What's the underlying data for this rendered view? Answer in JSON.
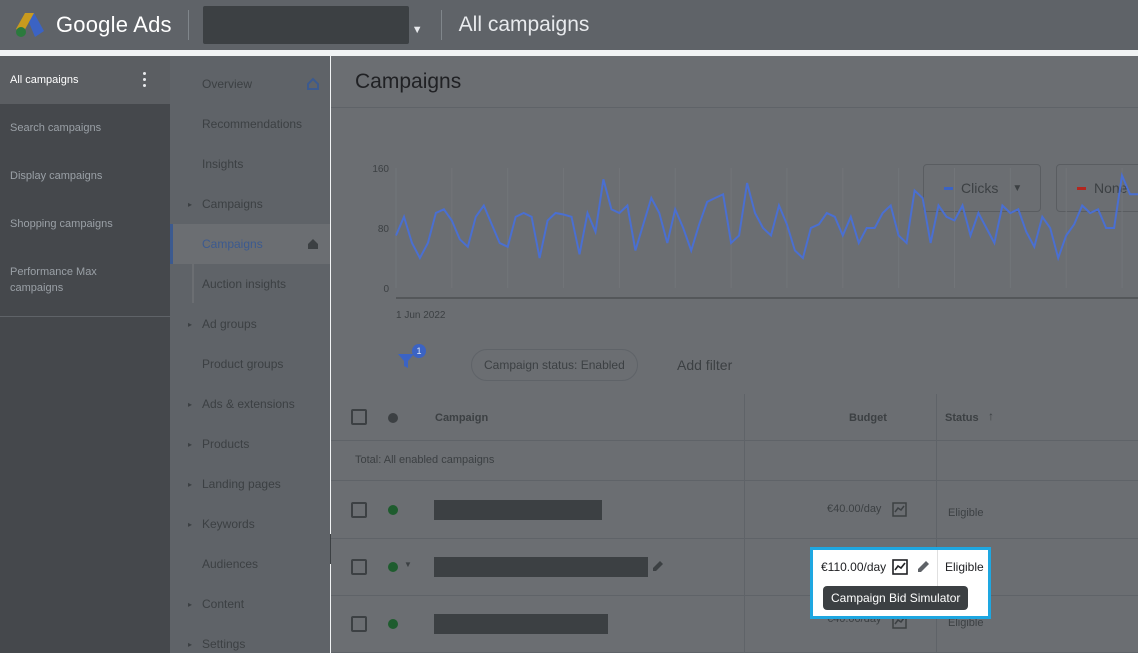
{
  "header": {
    "logo_text": "Google Ads",
    "page_title": "All campaigns"
  },
  "leftnav": {
    "active": "All campaigns",
    "items": [
      "Search campaigns",
      "Display campaigns",
      "Shopping campaigns",
      "Performance Max campaigns"
    ]
  },
  "subnav": {
    "items": [
      {
        "label": "Overview",
        "expandable": false
      },
      {
        "label": "Recommendations",
        "expandable": false
      },
      {
        "label": "Insights",
        "expandable": false
      },
      {
        "label": "Campaigns",
        "expandable": true
      },
      {
        "label": "Campaigns",
        "expandable": false,
        "selected": true
      },
      {
        "label": "Auction insights",
        "expandable": false
      },
      {
        "label": "Ad groups",
        "expandable": true
      },
      {
        "label": "Product groups",
        "expandable": false
      },
      {
        "label": "Ads & extensions",
        "expandable": true
      },
      {
        "label": "Products",
        "expandable": true
      },
      {
        "label": "Landing pages",
        "expandable": true
      },
      {
        "label": "Keywords",
        "expandable": true
      },
      {
        "label": "Audiences",
        "expandable": false
      },
      {
        "label": "Content",
        "expandable": true
      },
      {
        "label": "Settings",
        "expandable": true
      }
    ]
  },
  "main": {
    "title": "Campaigns",
    "metric1": "Clicks",
    "metric2": "None",
    "filter_badge": "1",
    "filter_chip": "Campaign status: Enabled",
    "add_filter": "Add filter"
  },
  "table": {
    "headers": {
      "campaign": "Campaign",
      "budget": "Budget",
      "status": "Status"
    },
    "total_label": "Total: All enabled campaigns",
    "rows": [
      {
        "budget": "€40.00/day",
        "status": "Eligible"
      },
      {
        "budget": "€110.00/day",
        "status": "Eligible"
      },
      {
        "budget": "€40.00/day",
        "status": "Eligible"
      }
    ]
  },
  "tooltip": "Campaign Bid Simulator",
  "colors": {
    "accent": "#1a73e8",
    "highlight": "#1ea7e1",
    "series": "#4a6fd1"
  },
  "chart_data": {
    "type": "line",
    "title": "",
    "xlabel": "",
    "ylabel": "",
    "x_start_label": "1 Jun 2022",
    "yticks": [
      0,
      80,
      160
    ],
    "ylim": [
      0,
      160
    ],
    "grid": true,
    "series": [
      {
        "values": [
          70,
          95,
          60,
          40,
          60,
          100,
          105,
          90,
          65,
          55,
          95,
          110,
          85,
          60,
          55,
          95,
          100,
          95,
          40,
          90,
          100,
          98,
          95,
          45,
          100,
          75,
          145,
          105,
          100,
          110,
          50,
          85,
          120,
          100,
          60,
          105,
          80,
          50,
          85,
          115,
          120,
          125,
          60,
          70,
          140,
          100,
          80,
          70,
          110,
          85,
          50,
          40,
          80,
          85,
          100,
          95,
          70,
          95,
          60,
          80,
          80,
          100,
          110,
          70,
          60,
          130,
          120,
          60,
          110,
          95,
          90,
          110,
          70,
          100,
          80,
          60,
          110,
          100,
          105,
          75,
          55,
          95,
          80,
          40,
          70,
          85,
          110,
          100,
          105,
          80,
          80,
          150,
          125,
          125
        ]
      }
    ]
  }
}
